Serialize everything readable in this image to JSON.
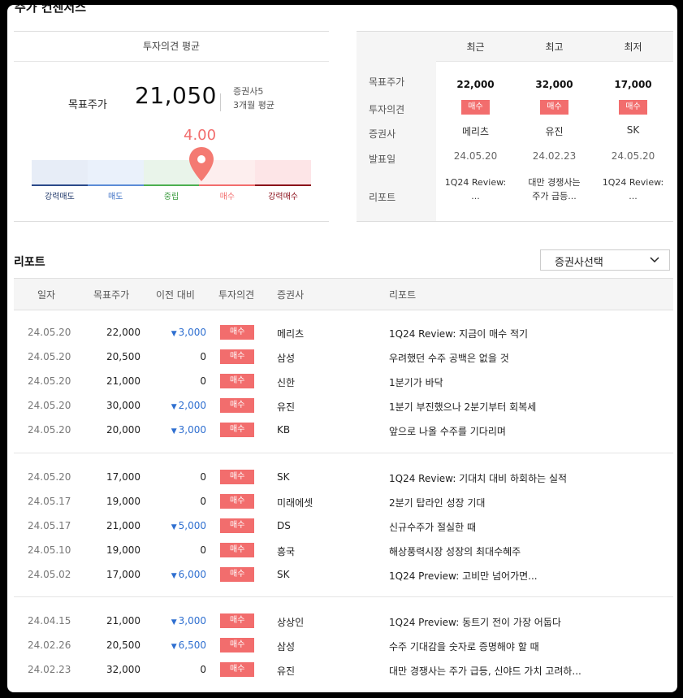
{
  "consensus": {
    "title": "주가 컨센서스",
    "avg_title": "투자의견 평균",
    "target_label": "목표주가",
    "target_value": "21,050",
    "broker_count": "증권사5",
    "period_avg": "3개월 평균",
    "score": "4.00",
    "score_level": 4.0,
    "scale_labels": [
      "강력매도",
      "매도",
      "중립",
      "매수",
      "강력매수"
    ],
    "scale_colors": {
      "seg_fill": [
        "#e7edf7",
        "#eaf1fb",
        "#e9f4ea",
        "#fdeeee",
        "#fde5e7"
      ],
      "seg_line": [
        "#2b4a8a",
        "#5b8bd6",
        "#4caf50",
        "#f26d6d",
        "#8b0f1a"
      ],
      "label": [
        "#223a6b",
        "#3c6fc4",
        "#3a9a3e",
        "#f26d6d",
        "#8b0f1a"
      ]
    },
    "accent": "#f26d6d"
  },
  "comparison": {
    "headers": [
      "최근",
      "최고",
      "최저"
    ],
    "row_labels": [
      "목표주가",
      "투자의견",
      "증권사",
      "발표일",
      "리포트"
    ],
    "columns": [
      {
        "target": "22,000",
        "opinion": "매수",
        "broker": "메리츠",
        "date": "24.05.20",
        "report_l1": "1Q24 Review:",
        "report_l2": "..."
      },
      {
        "target": "32,000",
        "opinion": "매수",
        "broker": "유진",
        "date": "24.02.23",
        "report_l1": "대만 경쟁사는",
        "report_l2": "주가 급등..."
      },
      {
        "target": "17,000",
        "opinion": "매수",
        "broker": "SK",
        "date": "24.05.20",
        "report_l1": "1Q24 Review:",
        "report_l2": "..."
      }
    ]
  },
  "report": {
    "title": "리포트",
    "broker_select": "증권사선택",
    "columns": [
      "일자",
      "목표주가",
      "이전 대비",
      "투자의견",
      "증권사",
      "리포트"
    ],
    "groups": [
      [
        {
          "date": "24.05.20",
          "target": "22,000",
          "diff": "3,000",
          "dir": "down",
          "opinion": "매수",
          "broker": "메리츠",
          "title": "1Q24 Review: 지금이 매수 적기"
        },
        {
          "date": "24.05.20",
          "target": "20,500",
          "diff": "0",
          "dir": "zero",
          "opinion": "매수",
          "broker": "삼성",
          "title": "우려했던 수주 공백은 없을 것"
        },
        {
          "date": "24.05.20",
          "target": "21,000",
          "diff": "0",
          "dir": "zero",
          "opinion": "매수",
          "broker": "신한",
          "title": "1분기가 바닥"
        },
        {
          "date": "24.05.20",
          "target": "30,000",
          "diff": "2,000",
          "dir": "down",
          "opinion": "매수",
          "broker": "유진",
          "title": "1분기 부진했으나 2분기부터 회복세"
        },
        {
          "date": "24.05.20",
          "target": "20,000",
          "diff": "3,000",
          "dir": "down",
          "opinion": "매수",
          "broker": "KB",
          "title": "앞으로 나올 수주를 기다리며"
        }
      ],
      [
        {
          "date": "24.05.20",
          "target": "17,000",
          "diff": "0",
          "dir": "zero",
          "opinion": "매수",
          "broker": "SK",
          "title": "1Q24 Review: 기대치 대비 하회하는 실적"
        },
        {
          "date": "24.05.17",
          "target": "19,000",
          "diff": "0",
          "dir": "zero",
          "opinion": "매수",
          "broker": "미래에셋",
          "title": "2분기 탑라인 성장 기대"
        },
        {
          "date": "24.05.17",
          "target": "21,000",
          "diff": "5,000",
          "dir": "down",
          "opinion": "매수",
          "broker": "DS",
          "title": "신규수주가 절실한 때"
        },
        {
          "date": "24.05.10",
          "target": "19,000",
          "diff": "0",
          "dir": "zero",
          "opinion": "매수",
          "broker": "흥국",
          "title": "해상풍력시장 성장의 최대수혜주"
        },
        {
          "date": "24.05.02",
          "target": "17,000",
          "diff": "6,000",
          "dir": "down",
          "opinion": "매수",
          "broker": "SK",
          "title": "1Q24 Preview: 고비만 넘어가면..."
        }
      ],
      [
        {
          "date": "24.04.15",
          "target": "21,000",
          "diff": "3,000",
          "dir": "down",
          "opinion": "매수",
          "broker": "상상인",
          "title": "1Q24 Preview: 동트기 전이 가장 어둡다"
        },
        {
          "date": "24.02.26",
          "target": "20,500",
          "diff": "6,500",
          "dir": "down",
          "opinion": "매수",
          "broker": "삼성",
          "title": "수주 기대감을 숫자로 증명해야 할 때"
        },
        {
          "date": "24.02.23",
          "target": "32,000",
          "diff": "0",
          "dir": "zero",
          "opinion": "매수",
          "broker": "유진",
          "title": "대만 경쟁사는 주가 급등, 신야드 가치 고려하..."
        }
      ]
    ]
  }
}
